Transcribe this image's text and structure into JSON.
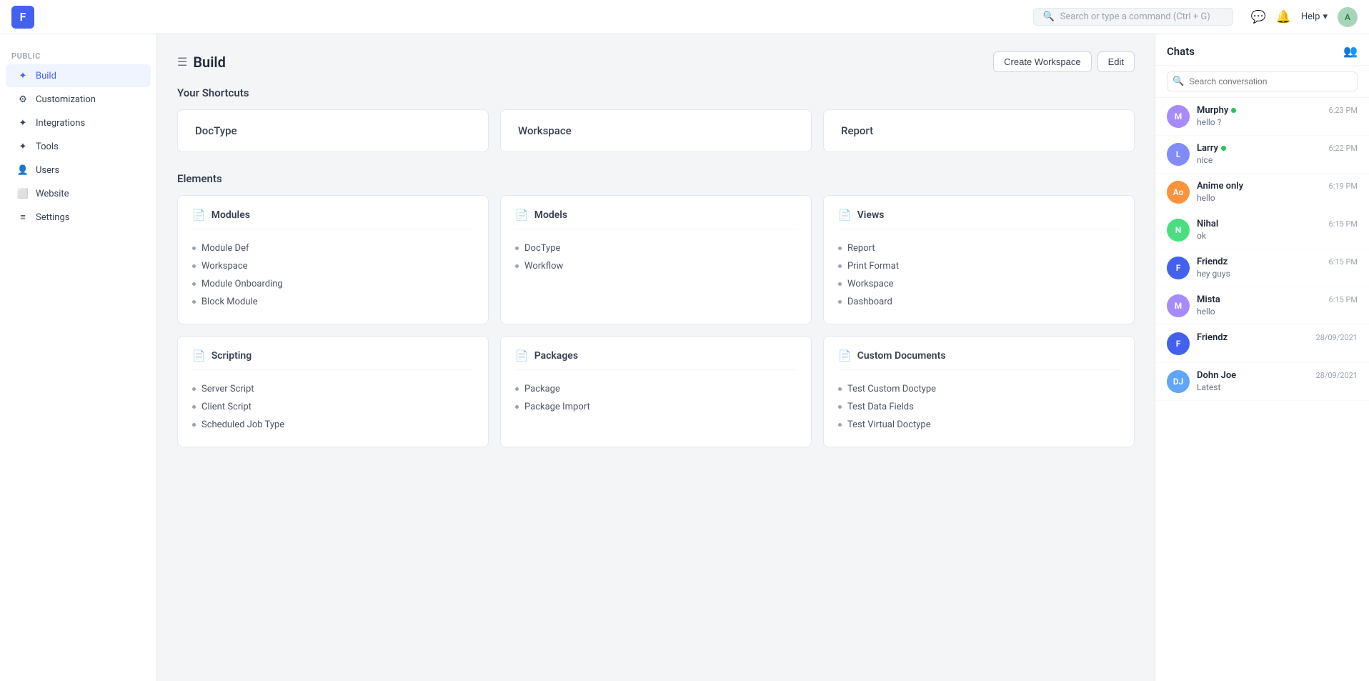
{
  "app": {
    "logo": "F",
    "logo_bg": "#4361ee"
  },
  "topnav": {
    "search_placeholder": "Search or type a command (Ctrl + G)",
    "help_label": "Help",
    "avatar_initials": "A"
  },
  "sidebar": {
    "section_label": "PUBLIC",
    "items": [
      {
        "id": "build",
        "label": "Build",
        "active": true
      },
      {
        "id": "customization",
        "label": "Customization",
        "active": false
      },
      {
        "id": "integrations",
        "label": "Integrations",
        "active": false
      },
      {
        "id": "tools",
        "label": "Tools",
        "active": false
      },
      {
        "id": "users",
        "label": "Users",
        "active": false
      },
      {
        "id": "website",
        "label": "Website",
        "active": false
      },
      {
        "id": "settings",
        "label": "Settings",
        "active": false
      }
    ]
  },
  "page": {
    "title": "Build",
    "create_workspace_label": "Create Workspace",
    "edit_label": "Edit"
  },
  "shortcuts": {
    "title": "Your Shortcuts",
    "items": [
      {
        "label": "DocType"
      },
      {
        "label": "Workspace"
      },
      {
        "label": "Report"
      }
    ]
  },
  "elements": {
    "title": "Elements",
    "cards": [
      {
        "id": "modules",
        "title": "Modules",
        "items": [
          "Module Def",
          "Workspace",
          "Module Onboarding",
          "Block Module"
        ]
      },
      {
        "id": "models",
        "title": "Models",
        "items": [
          "DocType",
          "Workflow"
        ]
      },
      {
        "id": "views",
        "title": "Views",
        "items": [
          "Report",
          "Print Format",
          "Workspace",
          "Dashboard"
        ]
      },
      {
        "id": "scripting",
        "title": "Scripting",
        "items": [
          "Server Script",
          "Client Script",
          "Scheduled Job Type"
        ]
      },
      {
        "id": "packages",
        "title": "Packages",
        "items": [
          "Package",
          "Package Import"
        ]
      },
      {
        "id": "custom-documents",
        "title": "Custom Documents",
        "items": [
          "Test Custom Doctype",
          "Test Data Fields",
          "Test Virtual Doctype"
        ]
      }
    ]
  },
  "chats": {
    "title": "Chats",
    "search_placeholder": "Search conversation",
    "items": [
      {
        "id": "murphy",
        "initials": "M",
        "name": "Murphy",
        "online": true,
        "time": "6:23 PM",
        "preview": "hello ?",
        "color": "#a78bfa"
      },
      {
        "id": "larry",
        "initials": "L",
        "name": "Larry",
        "online": true,
        "time": "6:22 PM",
        "preview": "nice",
        "color": "#818cf8"
      },
      {
        "id": "anime-only",
        "initials": "Ao",
        "name": "Anime only",
        "online": false,
        "time": "6:19 PM",
        "preview": "hello",
        "color": "#fb923c"
      },
      {
        "id": "nihal",
        "initials": "N",
        "name": "Nihal",
        "online": false,
        "time": "6:15 PM",
        "preview": "ok",
        "color": "#4ade80"
      },
      {
        "id": "friendz1",
        "initials": "F",
        "name": "Friendz",
        "online": false,
        "time": "6:15 PM",
        "preview": "hey guys",
        "color": "#4361ee"
      },
      {
        "id": "mista",
        "initials": "M",
        "name": "Mista",
        "online": false,
        "time": "6:15 PM",
        "preview": "hello",
        "color": "#a78bfa"
      },
      {
        "id": "friendz2",
        "initials": "F",
        "name": "Friendz",
        "online": false,
        "time": "28/09/2021",
        "preview": "",
        "color": "#4361ee"
      },
      {
        "id": "dohn-joe",
        "initials": "DJ",
        "name": "Dohn Joe",
        "online": false,
        "time": "28/09/2021",
        "preview": "Latest",
        "color": "#60a5fa"
      }
    ]
  }
}
